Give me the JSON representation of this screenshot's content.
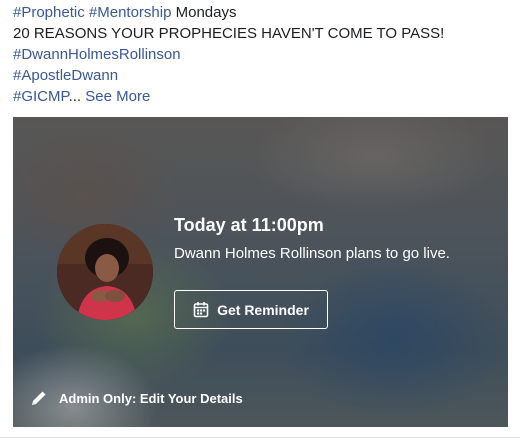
{
  "post": {
    "hashtag_prophetic": "#Prophetic",
    "hashtag_mentorship": "#Mentorship",
    "mondays": " Mondays",
    "headline": "20 REASONS YOUR PROPHECIES HAVEN'T COME TO PASS!",
    "hashtag_dwann": "#DwannHolmesRollinson",
    "hashtag_apostle": "#ApostleDwann",
    "hashtag_gicmp": "#GICMP",
    "ellipsis": "...",
    "see_more": "See More"
  },
  "live": {
    "time": "Today at 11:00pm",
    "description": "Dwann Holmes Rollinson plans to go live.",
    "reminder_label": "Get Reminder",
    "reminder_icon": "calendar-icon",
    "admin_label": "Admin Only: Edit Your Details",
    "admin_icon": "pencil-icon",
    "avatar_alt": "profile photo"
  },
  "colors": {
    "link": "#385898",
    "text": "#1c1e21"
  }
}
